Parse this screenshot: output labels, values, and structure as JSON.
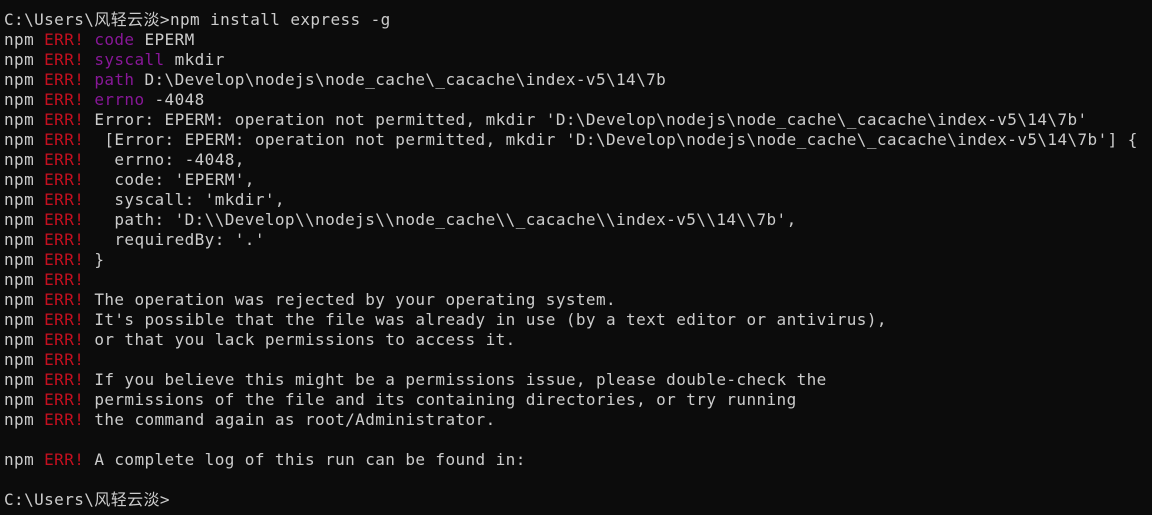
{
  "terminal": {
    "colors": {
      "background": "#0c0c0c",
      "foreground": "#cccccc",
      "error": "#c50f1f",
      "keyword": "#881798"
    },
    "command_line": {
      "prompt": "C:\\Users\\风轻云淡>",
      "command": "npm install express -g"
    },
    "log_lines": [
      {
        "prefix": "npm ",
        "tag": "ERR! ",
        "key": "code",
        "text": " EPERM"
      },
      {
        "prefix": "npm ",
        "tag": "ERR! ",
        "key": "syscall",
        "text": " mkdir"
      },
      {
        "prefix": "npm ",
        "tag": "ERR! ",
        "key": "path",
        "text": " D:\\Develop\\nodejs\\node_cache\\_cacache\\index-v5\\14\\7b"
      },
      {
        "prefix": "npm ",
        "tag": "ERR! ",
        "key": "errno",
        "text": " -4048"
      },
      {
        "prefix": "npm ",
        "tag": "ERR! ",
        "key": "",
        "text": "Error: EPERM: operation not permitted, mkdir 'D:\\Develop\\nodejs\\node_cache\\_cacache\\index-v5\\14\\7b'"
      },
      {
        "prefix": "npm ",
        "tag": "ERR! ",
        "key": "",
        "text": " [Error: EPERM: operation not permitted, mkdir 'D:\\Develop\\nodejs\\node_cache\\_cacache\\index-v5\\14\\7b'] {"
      },
      {
        "prefix": "npm ",
        "tag": "ERR! ",
        "key": "",
        "text": "  errno: -4048,"
      },
      {
        "prefix": "npm ",
        "tag": "ERR! ",
        "key": "",
        "text": "  code: 'EPERM',"
      },
      {
        "prefix": "npm ",
        "tag": "ERR! ",
        "key": "",
        "text": "  syscall: 'mkdir',"
      },
      {
        "prefix": "npm ",
        "tag": "ERR! ",
        "key": "",
        "text": "  path: 'D:\\\\Develop\\\\nodejs\\\\node_cache\\\\_cacache\\\\index-v5\\\\14\\\\7b',"
      },
      {
        "prefix": "npm ",
        "tag": "ERR! ",
        "key": "",
        "text": "  requiredBy: '.'"
      },
      {
        "prefix": "npm ",
        "tag": "ERR! ",
        "key": "",
        "text": "}"
      },
      {
        "prefix": "npm ",
        "tag": "ERR! ",
        "key": "",
        "text": ""
      },
      {
        "prefix": "npm ",
        "tag": "ERR! ",
        "key": "",
        "text": "The operation was rejected by your operating system."
      },
      {
        "prefix": "npm ",
        "tag": "ERR! ",
        "key": "",
        "text": "It's possible that the file was already in use (by a text editor or antivirus),"
      },
      {
        "prefix": "npm ",
        "tag": "ERR! ",
        "key": "",
        "text": "or that you lack permissions to access it."
      },
      {
        "prefix": "npm ",
        "tag": "ERR! ",
        "key": "",
        "text": ""
      },
      {
        "prefix": "npm ",
        "tag": "ERR! ",
        "key": "",
        "text": "If you believe this might be a permissions issue, please double-check the"
      },
      {
        "prefix": "npm ",
        "tag": "ERR! ",
        "key": "",
        "text": "permissions of the file and its containing directories, or try running"
      },
      {
        "prefix": "npm ",
        "tag": "ERR! ",
        "key": "",
        "text": "the command again as root/Administrator."
      },
      {
        "prefix": "",
        "tag": "",
        "key": "",
        "text": ""
      },
      {
        "prefix": "npm ",
        "tag": "ERR! ",
        "key": "",
        "text": "A complete log of this run can be found in:"
      },
      {
        "prefix": "",
        "tag": "",
        "key": "",
        "text": ""
      }
    ],
    "final_prompt": "C:\\Users\\风轻云淡>"
  }
}
